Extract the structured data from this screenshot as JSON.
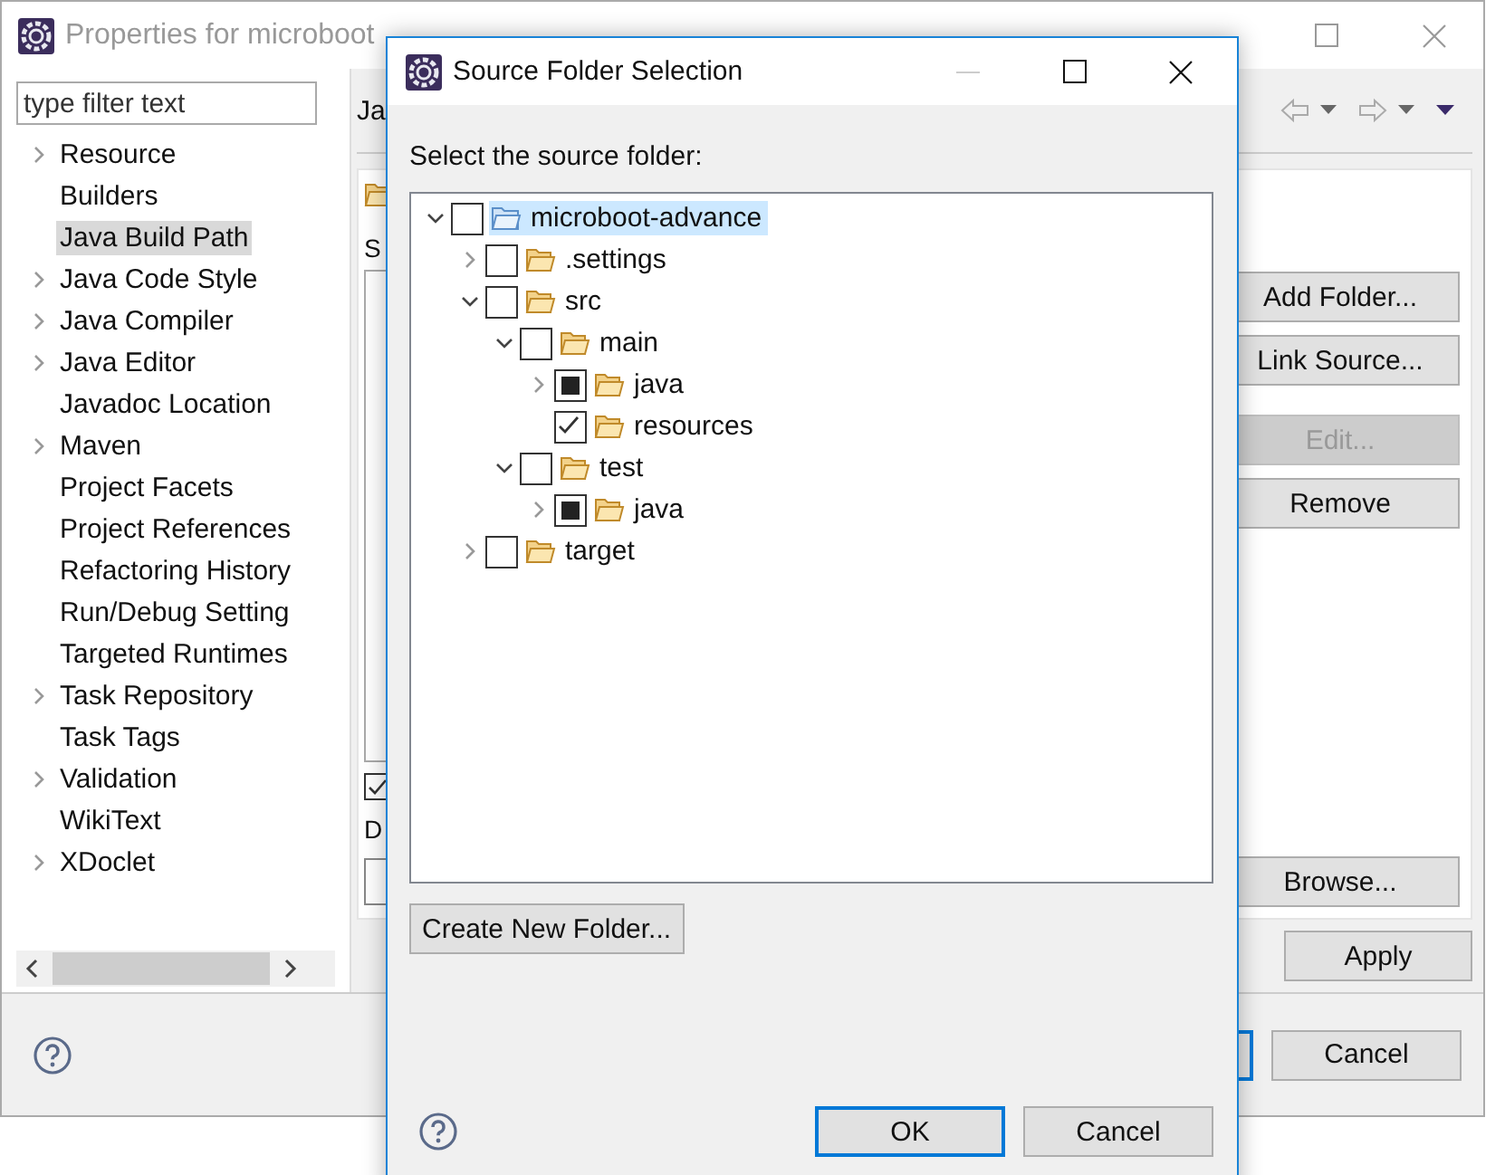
{
  "window": {
    "title": "Properties for microboot",
    "filter": {
      "placeholder": "type filter text"
    },
    "nav": [
      {
        "label": "Resource",
        "expandable": true,
        "selected": false
      },
      {
        "label": "Builders",
        "expandable": false,
        "selected": false
      },
      {
        "label": "Java Build Path",
        "expandable": false,
        "selected": true
      },
      {
        "label": "Java Code Style",
        "expandable": true,
        "selected": false
      },
      {
        "label": "Java Compiler",
        "expandable": true,
        "selected": false
      },
      {
        "label": "Java Editor",
        "expandable": true,
        "selected": false
      },
      {
        "label": "Javadoc Location",
        "expandable": false,
        "selected": false
      },
      {
        "label": "Maven",
        "expandable": true,
        "selected": false
      },
      {
        "label": "Project Facets",
        "expandable": false,
        "selected": false
      },
      {
        "label": "Project References",
        "expandable": false,
        "selected": false
      },
      {
        "label": "Refactoring History",
        "expandable": false,
        "selected": false
      },
      {
        "label": "Run/Debug Setting",
        "expandable": false,
        "selected": false
      },
      {
        "label": "Targeted Runtimes",
        "expandable": false,
        "selected": false
      },
      {
        "label": "Task Repository",
        "expandable": true,
        "selected": false
      },
      {
        "label": "Task Tags",
        "expandable": false,
        "selected": false
      },
      {
        "label": "Validation",
        "expandable": true,
        "selected": false
      },
      {
        "label": "WikiText",
        "expandable": false,
        "selected": false
      },
      {
        "label": "XDoclet",
        "expandable": true,
        "selected": false
      }
    ],
    "page_title": "Ja",
    "section_label": "S",
    "option_checked": true,
    "field_label": "D",
    "buttons": [
      {
        "label": "Add Folder...",
        "disabled": false
      },
      {
        "label": "Link Source...",
        "disabled": false
      },
      {
        "label": "Edit...",
        "disabled": true
      },
      {
        "label": "Remove",
        "disabled": false
      }
    ],
    "browse_button": "Browse...",
    "apply_button": "Apply",
    "cancel_button": "Cancel"
  },
  "dialog": {
    "title": "Source Folder Selection",
    "prompt": "Select the source folder:",
    "tree": [
      {
        "label": "microboot-advance",
        "kind": "project",
        "expanded": true,
        "checked": false,
        "partial": false,
        "selected": true,
        "children": [
          {
            "label": ".settings",
            "kind": "folder",
            "expanded": false,
            "checked": false,
            "partial": false,
            "selected": false
          },
          {
            "label": "src",
            "kind": "folder",
            "expanded": true,
            "checked": false,
            "partial": false,
            "selected": false,
            "children": [
              {
                "label": "main",
                "kind": "folder",
                "expanded": true,
                "checked": false,
                "partial": false,
                "selected": false,
                "children": [
                  {
                    "label": "java",
                    "kind": "folder",
                    "expanded": false,
                    "checked": false,
                    "partial": true,
                    "selected": false
                  },
                  {
                    "label": "resources",
                    "kind": "folder",
                    "checked": true,
                    "partial": false,
                    "selected": false
                  }
                ]
              },
              {
                "label": "test",
                "kind": "folder",
                "expanded": true,
                "checked": false,
                "partial": false,
                "selected": false,
                "children": [
                  {
                    "label": "java",
                    "kind": "folder",
                    "expanded": false,
                    "checked": false,
                    "partial": true,
                    "selected": false
                  }
                ]
              }
            ]
          },
          {
            "label": "target",
            "kind": "folder",
            "expanded": false,
            "checked": false,
            "partial": false,
            "selected": false
          }
        ]
      }
    ],
    "create_button": "Create New Folder...",
    "ok_button": "OK",
    "cancel_button": "Cancel"
  }
}
